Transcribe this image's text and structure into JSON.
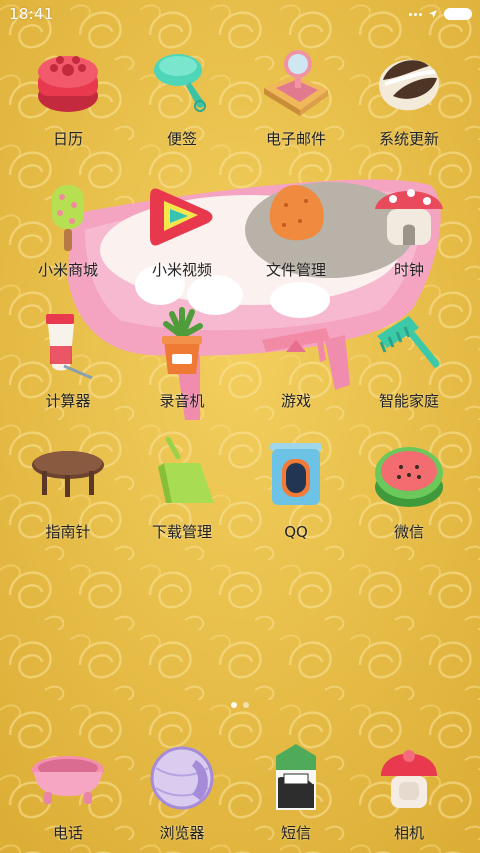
{
  "status_bar": {
    "time": "18:41",
    "icons": [
      "more-dots-icon",
      "location-arrow-icon",
      "battery-icon"
    ]
  },
  "apps": [
    {
      "label": "日历",
      "icon": "cake-calendar-icon"
    },
    {
      "label": "便签",
      "icon": "scoop-notes-icon"
    },
    {
      "label": "电子邮件",
      "icon": "mirror-mail-icon"
    },
    {
      "label": "系统更新",
      "icon": "sunflower-seed-update-icon"
    },
    {
      "label": "小米商城",
      "icon": "ice-pop-store-icon"
    },
    {
      "label": "小米视频",
      "icon": "play-triangle-video-icon"
    },
    {
      "label": "文件管理",
      "icon": "cookie-files-icon"
    },
    {
      "label": "时钟",
      "icon": "mushroom-house-clock-icon"
    },
    {
      "label": "计算器",
      "icon": "water-bottle-calculator-icon"
    },
    {
      "label": "录音机",
      "icon": "plant-pot-recorder-icon"
    },
    {
      "label": "游戏",
      "icon": "seesaw-game-icon"
    },
    {
      "label": "智能家庭",
      "icon": "comb-smarthome-icon"
    },
    {
      "label": "指南针",
      "icon": "wooden-table-compass-icon"
    },
    {
      "label": "下载管理",
      "icon": "dustpan-download-icon"
    },
    {
      "label": "QQ",
      "icon": "tin-can-qq-icon"
    },
    {
      "label": "微信",
      "icon": "watermelon-wechat-icon"
    }
  ],
  "pager": {
    "count": 2,
    "active": 1
  },
  "dock": [
    {
      "label": "电话",
      "icon": "bathtub-phone-icon"
    },
    {
      "label": "浏览器",
      "icon": "hamster-ball-browser-icon"
    },
    {
      "label": "短信",
      "icon": "milk-carton-sms-icon"
    },
    {
      "label": "相机",
      "icon": "mushroom-camera-icon"
    }
  ],
  "colors": {
    "wallpaper": "#e9be45",
    "bathtub": "#f4a3c0",
    "label_text": "#222222"
  }
}
